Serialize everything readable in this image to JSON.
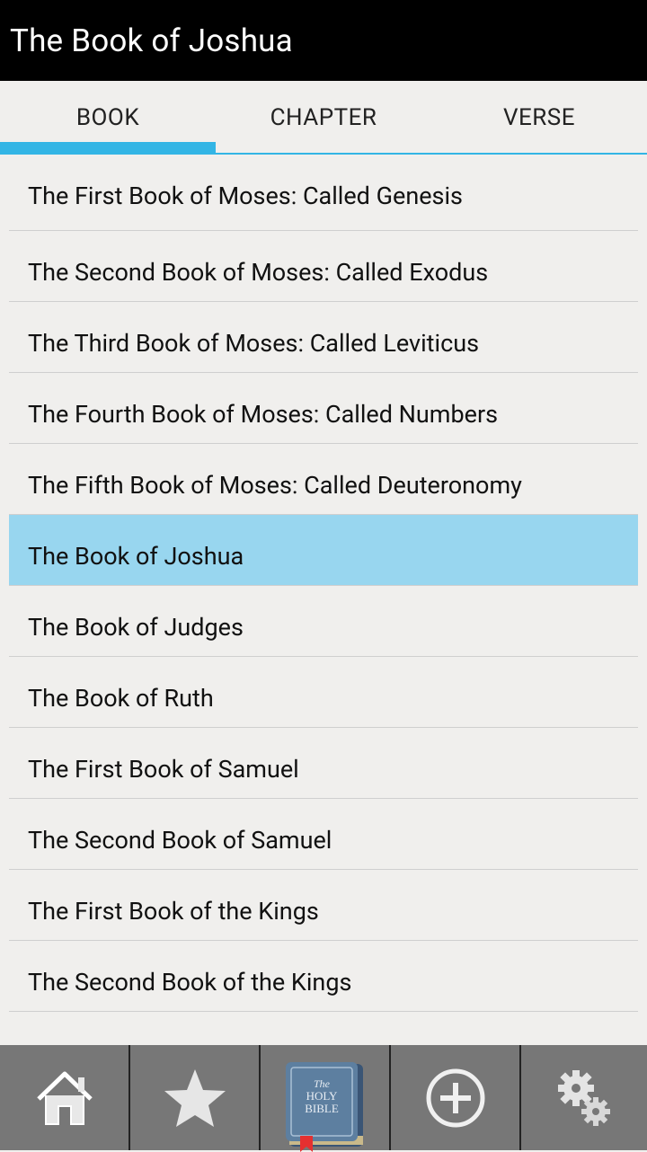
{
  "app": {
    "title": "The Book of Joshua"
  },
  "tabs": [
    {
      "label": "BOOK",
      "active": true
    },
    {
      "label": "CHAPTER",
      "active": false
    },
    {
      "label": "VERSE",
      "active": false
    }
  ],
  "books": [
    {
      "label": "The First Book of Moses: Called Genesis",
      "selected": false
    },
    {
      "label": "The Second Book of Moses: Called Exodus",
      "selected": false
    },
    {
      "label": "The Third Book of Moses: Called Leviticus",
      "selected": false
    },
    {
      "label": "The Fourth Book of Moses: Called Numbers",
      "selected": false
    },
    {
      "label": "The Fifth Book of Moses: Called Deuteronomy",
      "selected": false
    },
    {
      "label": "The Book of Joshua",
      "selected": true
    },
    {
      "label": "The Book of Judges",
      "selected": false
    },
    {
      "label": "The Book of Ruth",
      "selected": false
    },
    {
      "label": "The First Book of Samuel",
      "selected": false
    },
    {
      "label": "The Second Book of Samuel",
      "selected": false
    },
    {
      "label": "The First Book of the Kings",
      "selected": false
    },
    {
      "label": "The Second Book of the Kings",
      "selected": false
    }
  ],
  "bottom_nav": {
    "items": [
      {
        "icon": "home-icon"
      },
      {
        "icon": "star-icon"
      },
      {
        "icon": "holy-bible-icon",
        "book_text": [
          "The",
          "HOLY",
          "BIBLE"
        ]
      },
      {
        "icon": "add-circle-icon"
      },
      {
        "icon": "gears-icon"
      }
    ]
  },
  "colors": {
    "accent": "#33b5e5",
    "selected_row": "#98d6ef",
    "titlebar": "#000000",
    "bottom_bar": "#777777"
  }
}
